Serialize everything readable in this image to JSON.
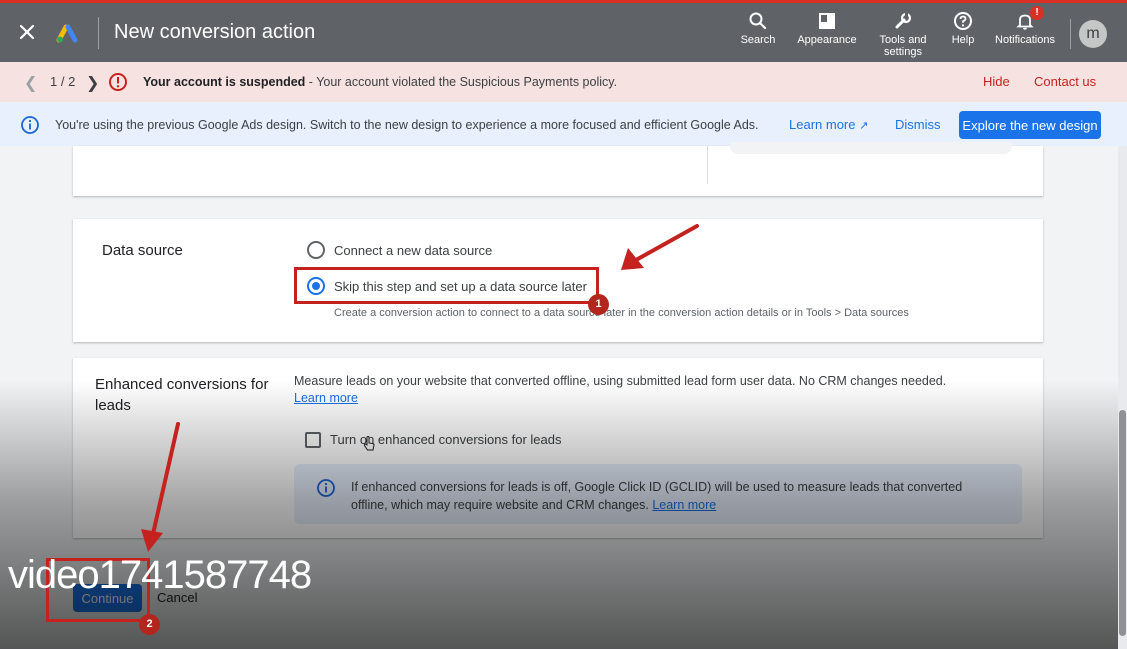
{
  "header": {
    "title": "New conversion action",
    "tools": [
      {
        "label": "Search",
        "icon": "search-icon"
      },
      {
        "label": "Appearance",
        "icon": "appearance-icon"
      },
      {
        "label": "Tools and settings",
        "icon": "wrench-icon"
      },
      {
        "label": "Help",
        "icon": "help-icon"
      },
      {
        "label": "Notifications",
        "icon": "bell-icon"
      }
    ],
    "notification_badge": "!",
    "avatar_initial": "m"
  },
  "suspend_bar": {
    "page_count": "1 / 2",
    "headline": "Your account is suspended",
    "message": " - Your account violated the Suspicious Payments policy.",
    "hide": "Hide",
    "contact": "Contact us"
  },
  "info_bar": {
    "message": "You're using the previous Google Ads design. Switch to the new design to experience a more focused and efficient Google Ads.",
    "learn_more": "Learn more",
    "dismiss": "Dismiss",
    "explore": "Explore the new design"
  },
  "data_source": {
    "label": "Data source",
    "option_connect": "Connect a new data source",
    "option_skip": "Skip this step and set up a data source later",
    "selected": "skip",
    "hint": "Create a conversion action to connect to a data source later in the conversion action details or in Tools > Data sources"
  },
  "enhanced": {
    "label": "Enhanced conversions for leads",
    "description": "Measure leads on your website that converted offline, using submitted lead form user data. No CRM changes needed.",
    "learn_more": "Learn more",
    "checkbox_label": "Turn on enhanced conversions for leads",
    "note": "If enhanced conversions for leads is off, Google Click ID (GCLID) will be used to measure leads that converted offline, which may require website and CRM changes.",
    "note_link": "Learn more"
  },
  "actions": {
    "continue": "Continue",
    "cancel": "Cancel"
  },
  "annotations": {
    "step1": "1",
    "step2": "2"
  },
  "watermark": "video1741587748",
  "colors": {
    "accent": "#1a73e8",
    "alert": "#c5221f",
    "topbar": "#5f6368"
  }
}
